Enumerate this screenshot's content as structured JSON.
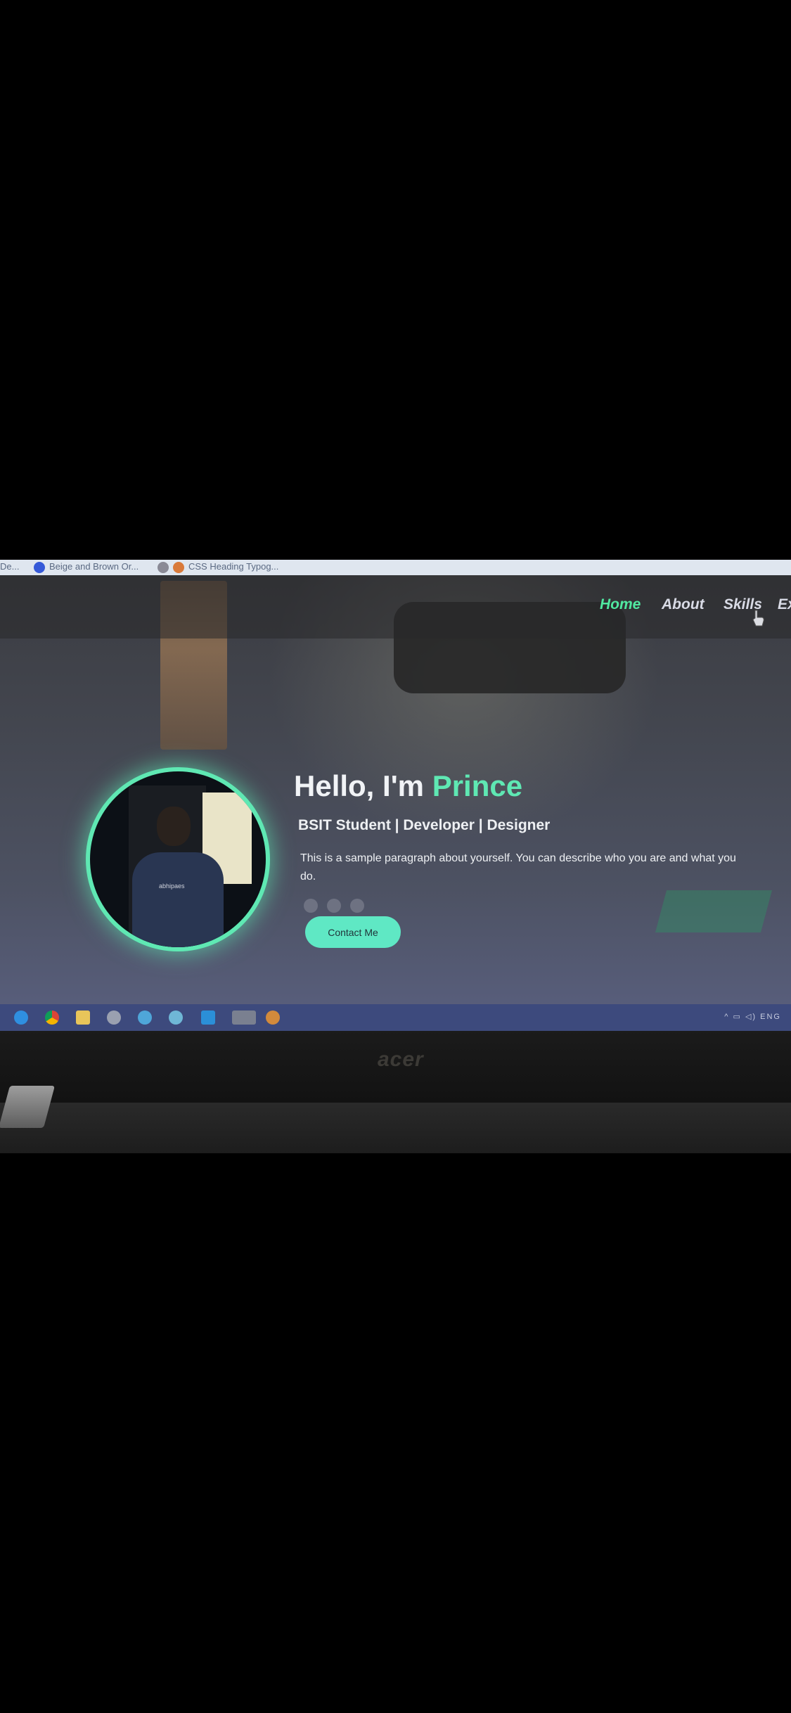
{
  "browser_tabs": [
    {
      "label": "De..."
    },
    {
      "label": "Beige and Brown Or..."
    },
    {
      "label": "CSS Heading Typog..."
    }
  ],
  "nav": {
    "items": [
      {
        "label": "Home",
        "active": true
      },
      {
        "label": "About"
      },
      {
        "label": "Skills"
      },
      {
        "label": "Ex"
      }
    ]
  },
  "hero": {
    "greeting": "Hello, I'm ",
    "name": "Prince",
    "subtitle": "BSIT Student | Developer | Designer",
    "description": "This is a sample paragraph about yourself. You can describe who you are and what you do.",
    "button": "Contact Me",
    "accent_color": "#5fe8b3"
  },
  "avatar": {
    "shirt_text": "abhipaes"
  },
  "taskbar": {
    "icons": [
      "edge-icon",
      "chrome-icon",
      "file-explorer-icon",
      "media-player-icon",
      "app-icon",
      "app-icon",
      "vscode-icon",
      "browser-icon",
      "app-icon"
    ],
    "tray_lang": "ENG"
  },
  "laptop": {
    "brand": "acer"
  }
}
